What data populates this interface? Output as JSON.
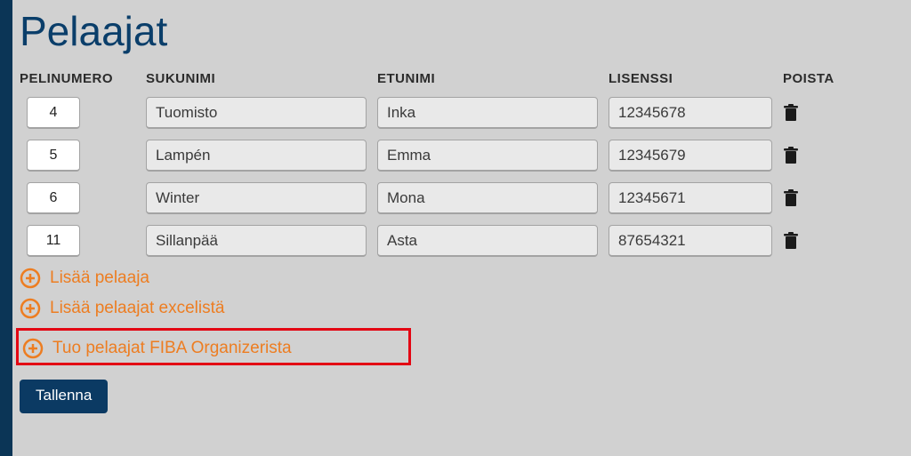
{
  "title": "Pelaajat",
  "columns": {
    "number": "PELINUMERO",
    "lastname": "SUKUNIMI",
    "firstname": "ETUNIMI",
    "license": "LISENSSI",
    "delete": "POISTA"
  },
  "players": [
    {
      "number": "4",
      "lastname": "Tuomisto",
      "firstname": "Inka",
      "license": "12345678"
    },
    {
      "number": "5",
      "lastname": "Lampén",
      "firstname": "Emma",
      "license": "12345679"
    },
    {
      "number": "6",
      "lastname": "Winter",
      "firstname": "Mona",
      "license": "12345671"
    },
    {
      "number": "11",
      "lastname": "Sillanpää",
      "firstname": "Asta",
      "license": "87654321"
    }
  ],
  "actions": {
    "add_player": "Lisää pelaaja",
    "add_from_excel": "Lisää pelaajat excelistä",
    "import_fiba": "Tuo pelaajat FIBA Organizerista",
    "save": "Tallenna"
  },
  "colors": {
    "accent_orange": "#ed7d21",
    "button_blue": "#0b3a63",
    "title_blue": "#0a3e6a",
    "highlight_red": "#e30613"
  }
}
